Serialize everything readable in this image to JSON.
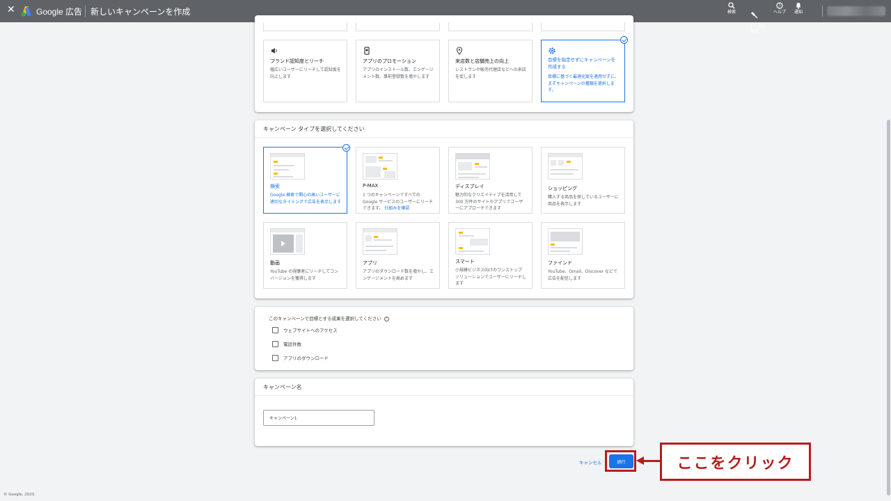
{
  "topbar": {
    "brand": "Google 広告",
    "page_title": "新しいキャンペーンを作成",
    "icons": [
      {
        "name": "search-icon",
        "label": "検索"
      },
      {
        "name": "tools-icon",
        "label": "ツールと\n設定"
      },
      {
        "name": "help-icon",
        "label": "ヘルプ"
      },
      {
        "name": "bell-icon",
        "label": "通知"
      }
    ]
  },
  "objectives": [
    {
      "title": "ブランド認知度とリーチ",
      "desc": "幅広いユーザーにリーチして認知度を向上します",
      "icon": "speaker-icon",
      "selected": false
    },
    {
      "title": "アプリのプロモーション",
      "desc": "アプリのインストール数、エンゲージメント数、事前登録数を増やします",
      "icon": "phone-icon",
      "selected": false
    },
    {
      "title": "来店数と店舗売上の向上",
      "desc": "レストランや販売代理店などへの来店を促します",
      "icon": "location-pin-icon",
      "selected": false
    },
    {
      "title": "目標を指定せずにキャンペーンを作成する",
      "desc": "目標に基づく最適化案を適用せずに、まずキャンペーンの種類を選択します。",
      "icon": "gear-icon",
      "selected": true
    }
  ],
  "campaign_type": {
    "title": "キャンペーン タイプを選択してください",
    "types": [
      {
        "title": "検索",
        "desc": "Google 検索で関心の高いユーザーに適切なタイミングで広告を表示します",
        "selected": true,
        "link": ""
      },
      {
        "title": "P-MAX",
        "desc": "1 つのキャンペーンですべての Google サービスのユーザーにリーチできます。",
        "selected": false,
        "link": "仕組みを確認"
      },
      {
        "title": "ディスプレイ",
        "desc": "魅力的なクリエイティブを活用して 300 万件のサイトやアプリでユーザーにアプローチできます",
        "selected": false,
        "link": ""
      },
      {
        "title": "ショッピング",
        "desc": "購入する商品を探しているユーザーに商品を表示します",
        "selected": false,
        "link": ""
      },
      {
        "title": "動画",
        "desc": "YouTube の視聴者にリーチしてコンバージョンを獲得します",
        "selected": false,
        "link": ""
      },
      {
        "title": "アプリ",
        "desc": "アプリのダウンロード数を増やし、エンゲージメントを高めます",
        "selected": false,
        "link": ""
      },
      {
        "title": "スマート",
        "desc": "小規模ビジネス向けのワンストップ ソリューションでユーザーにリーチします",
        "selected": false,
        "link": ""
      },
      {
        "title": "ファインド",
        "desc": "YouTube、Gmail、Discover などで広告を配信します",
        "selected": false,
        "link": ""
      }
    ]
  },
  "goals": {
    "question": "このキャンペーンで目標とする成果を選択してください",
    "options": [
      {
        "label": "ウェブサイトへのアクセス",
        "checked": false
      },
      {
        "label": "電話件数",
        "checked": false
      },
      {
        "label": "アプリのダウンロード",
        "checked": false
      }
    ]
  },
  "campaign_name": {
    "title": "キャンペーン名",
    "value": "キャンペーン1"
  },
  "actions": {
    "cancel": "キャンセル",
    "continue": "続行"
  },
  "annotation": {
    "callout": "ここをクリック",
    "color": "#b71c1c"
  },
  "footer": "© Google, 2023.",
  "colors": {
    "accent": "#1a73e8",
    "topbar": "#5f6368",
    "background": "#f1f3f4"
  }
}
